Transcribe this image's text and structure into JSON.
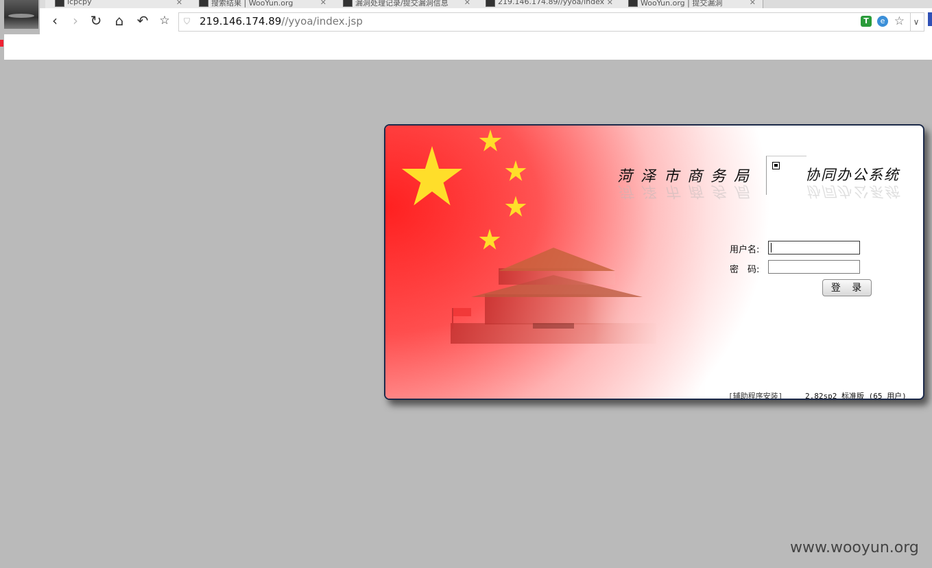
{
  "browser": {
    "tabs": [
      {
        "title": "icpcpy"
      },
      {
        "title": "搜索结果 | WooYun.org"
      },
      {
        "title": "漏洞处理记录/提交漏洞信息"
      },
      {
        "title": "219.146.174.89//yyoa/index"
      },
      {
        "title": "WooYun.org | 提交漏洞"
      }
    ],
    "address": {
      "host": "219.146.174.89",
      "path": "//yyoa/index.jsp"
    },
    "icons": {
      "back": "back-arrow-icon",
      "forward": "forward-arrow-icon",
      "reload": "reload-icon",
      "home": "home-icon",
      "undo": "undo-icon",
      "bookmark": "star-icon"
    }
  },
  "login": {
    "org_name": "菏泽市商务局",
    "system_name": "协同办公系统",
    "username_label": "用户名:",
    "password_label": "密　码:",
    "username_value": "",
    "password_value": "",
    "login_button": "登 录",
    "helper_link": "[辅助程序安装]",
    "version": "2.82sp2 标准版 (65 用户)"
  },
  "watermark": "www.wooyun.org",
  "colors": {
    "flag_red": "#ff1e1e",
    "star_yellow": "#ffde2a",
    "page_bg": "#bababa"
  }
}
